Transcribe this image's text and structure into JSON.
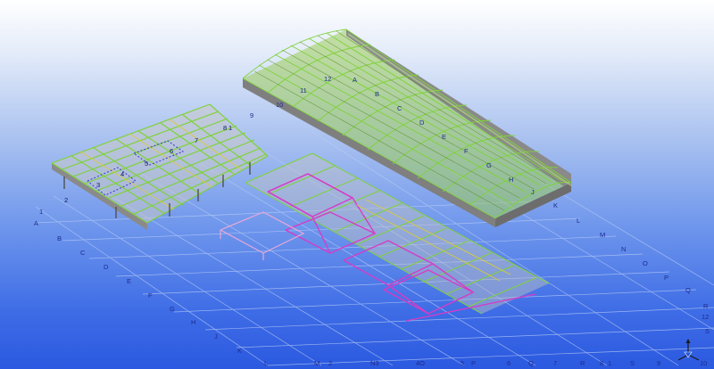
{
  "view": {
    "background_top": "#ffffff",
    "background_bottom": "#2b59e0",
    "grid_color": "#b9cdf5",
    "label_color": "#1e2b8f"
  },
  "grid_labels": {
    "left_numbers": [
      "1",
      "2"
    ],
    "left_letters": [
      "A",
      "B",
      "C",
      "D",
      "E",
      "F",
      "G",
      "H",
      "J",
      "K"
    ],
    "bottom_numbers": [
      "L",
      "M",
      "2",
      "N3",
      "4O",
      "5",
      "P",
      "6",
      "Q",
      "7",
      "R",
      "8",
      "1",
      "S",
      "9"
    ],
    "right_letters": [
      "K",
      "L",
      "M",
      "N",
      "O",
      "P",
      "Q",
      "R"
    ],
    "right_numbers": [
      "12",
      "S",
      "10"
    ],
    "roof_letters": [
      "A",
      "B",
      "C",
      "D",
      "E",
      "F",
      "G",
      "H",
      "J"
    ],
    "roof_numbers": [
      "12",
      "11",
      "10",
      "9"
    ],
    "left_deck_labels": [
      "8",
      "1",
      "7",
      "6",
      "5",
      "4",
      "3",
      "2"
    ]
  },
  "colors": {
    "steel_green": "#7fd23a",
    "beam_yellow": "#d8cc3a",
    "truss_magenta": "#d63cc6",
    "truss_pink": "#e9a8d8",
    "wall_gray": "#8a8a8a",
    "cladding_olive": "#7a9b35"
  },
  "gizmo": {
    "icon": "axis-triad-icon"
  }
}
